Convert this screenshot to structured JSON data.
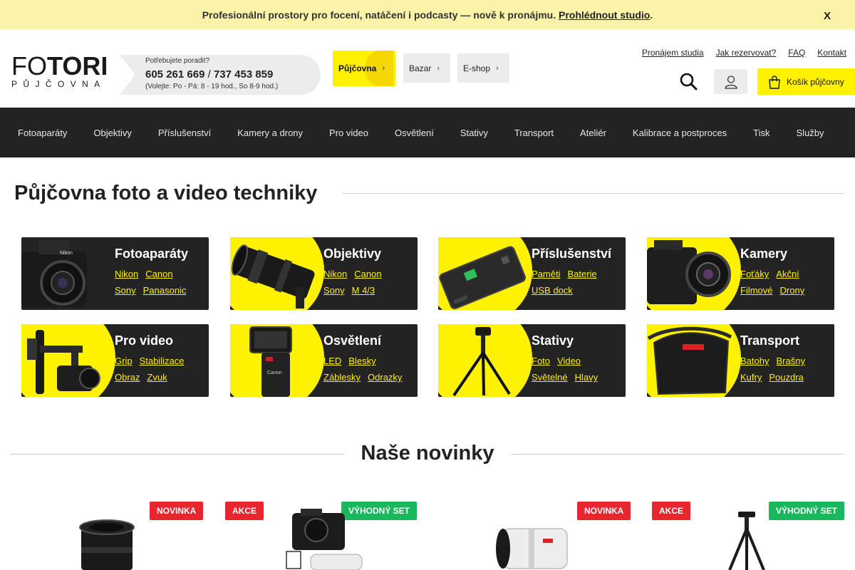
{
  "promo": {
    "text": "Profesionální prostory pro focení, natáčení i podcasty — nově k pronájmu.",
    "link": "Prohlédnout studio",
    "end": ".",
    "close": "X"
  },
  "logo": {
    "main_a": "FO",
    "main_b": "TORI",
    "sub": "PŮJČOVNA"
  },
  "help": {
    "question": "Potřebujete poradit?",
    "phone1": "605 261 669",
    "separator": " / ",
    "phone2": "737 453 859",
    "hours": "(Volejte: Po - Pá: 8 - 19 hod., So 8-9 hod.)"
  },
  "tabs": {
    "rent": "Půjčovna",
    "bazar": "Bazar",
    "eshop": "E-shop"
  },
  "toplinks": [
    "Pronájem studia",
    "Jak rezervovat?",
    "FAQ",
    "Kontakt"
  ],
  "cart": {
    "label": "Košík půjčovny"
  },
  "nav": [
    "Fotoaparáty",
    "Objektivy",
    "Příslušenství",
    "Kamery a drony",
    "Pro video",
    "Osvětlení",
    "Stativy",
    "Transport",
    "Ateliér",
    "Kalibrace a postproces",
    "Tisk",
    "Služby"
  ],
  "heading": "Půjčovna foto a video techniky",
  "categories": [
    {
      "title": "Fotoaparáty",
      "links": [
        [
          "Nikon",
          "Canon"
        ],
        [
          "Sony",
          "Panasonic"
        ]
      ]
    },
    {
      "title": "Objektivy",
      "links": [
        [
          "Nikon",
          "Canon"
        ],
        [
          "Sony",
          "M 4/3"
        ]
      ]
    },
    {
      "title": "Příslušenství",
      "links": [
        [
          "Paměti",
          "Baterie"
        ],
        [
          "USB dock"
        ]
      ]
    },
    {
      "title": "Kamery",
      "links": [
        [
          "Foťáky",
          "Akční"
        ],
        [
          "Filmové",
          "Drony"
        ]
      ]
    },
    {
      "title": "Pro video",
      "links": [
        [
          "Grip",
          "Stabilizace"
        ],
        [
          "Obraz",
          "Zvuk"
        ]
      ]
    },
    {
      "title": "Osvětlení",
      "links": [
        [
          "LED",
          "Blesky"
        ],
        [
          "Záblesky",
          "Odrazky"
        ]
      ]
    },
    {
      "title": "Stativy",
      "links": [
        [
          "Foto",
          "Video"
        ],
        [
          "Světelné",
          "Hlavy"
        ]
      ]
    },
    {
      "title": "Transport",
      "links": [
        [
          "Batohy",
          "Brašny"
        ],
        [
          "Kufry",
          "Pouzdra"
        ]
      ]
    }
  ],
  "news": {
    "title": "Naše novinky",
    "badges": [
      "NOVINKA",
      "AKCE",
      "VÝHODNÝ SET",
      "NOVINKA",
      "AKCE",
      "VÝHODNÝ SET"
    ]
  },
  "colors": {
    "yellow": "#fff200",
    "dark": "#232323",
    "red": "#e8262f",
    "green": "#1ab85c",
    "promo_bg": "#fbf3a8"
  }
}
